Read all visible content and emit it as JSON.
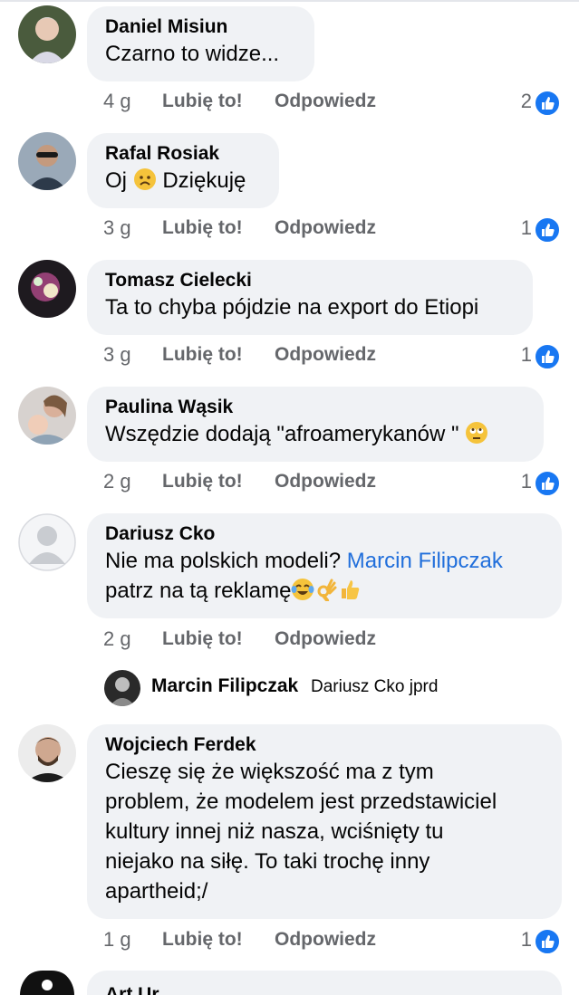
{
  "comments": [
    {
      "author": "Daniel Misiun",
      "text": "Czarno to widze...",
      "age": "4 g",
      "like": "Lubię to!",
      "reply": "Odpowiedz",
      "reactions": "2"
    },
    {
      "author": "Rafal Rosiak",
      "text_before": "Oj",
      "text_after": "Dziękuję",
      "emoji": "frowning-face",
      "age": "3 g",
      "like": "Lubię to!",
      "reply": "Odpowiedz",
      "reactions": "1"
    },
    {
      "author": "Tomasz Cielecki",
      "text": "Ta to chyba pójdzie na export do Etiopi",
      "age": "3 g",
      "like": "Lubię to!",
      "reply": "Odpowiedz",
      "reactions": "1"
    },
    {
      "author": "Paulina Wąsik",
      "text": "Wszędzie dodają \"afroamerykanów \"",
      "emoji": "face-with-rolling-eyes",
      "age": "2 g",
      "like": "Lubię to!",
      "reply": "Odpowiedz",
      "reactions": "1"
    },
    {
      "author": "Dariusz Cko",
      "text_before": "Nie ma polskich modeli?",
      "mention": "Marcin Filipczak",
      "text_line2": "patrz na tą reklamę",
      "emojis": [
        "face-with-tears-of-joy",
        "ok-hand",
        "thumbs-up"
      ],
      "age": "2 g",
      "like": "Lubię to!",
      "reply": "Odpowiedz"
    },
    {
      "author": "Wojciech Ferdek",
      "lines": [
        "Cieszę się że większość ma z tym",
        "problem, że modelem jest przedstawiciel",
        "kultury innej niż nasza, wciśnięty tu",
        "niejako na siłę. To taki trochę inny",
        "apartheid;/"
      ],
      "age": "1 g",
      "like": "Lubię to!",
      "reply": "Odpowiedz",
      "reactions": "1"
    },
    {
      "author": "Art Ur"
    }
  ],
  "reply": {
    "author": "Marcin Filipczak",
    "text": "Dariusz Cko jprd"
  },
  "colors": {
    "bubble": "#f0f2f5",
    "meta": "#65676b",
    "mention": "#216fdb",
    "like_badge": "#1877f2"
  }
}
